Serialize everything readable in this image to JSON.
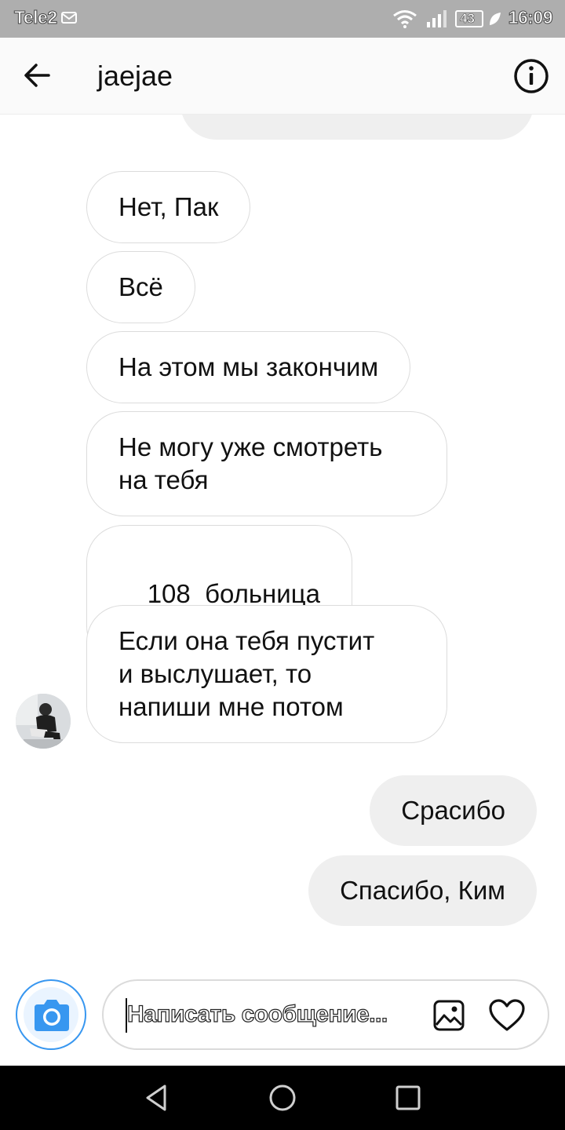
{
  "status_bar": {
    "carrier": "Tele2",
    "battery": "43",
    "time": "16:09"
  },
  "header": {
    "title": "jaejae",
    "back_icon": "arrow-left-icon",
    "info_icon": "info-circle-icon"
  },
  "messages": [
    {
      "sender": "them",
      "text": "Нет, Пак"
    },
    {
      "sender": "them",
      "text": "Всё"
    },
    {
      "sender": "them",
      "text": "На этом мы закончим"
    },
    {
      "sender": "them",
      "lines": [
        "Не могу уже смотреть",
        "на тебя"
      ]
    },
    {
      "sender": "them",
      "text": "108  больница"
    },
    {
      "sender": "them",
      "lines": [
        "Если она тебя пустит",
        "и выслушает, то",
        "напиши мне потом"
      ]
    },
    {
      "sender": "me",
      "text": "Срасибо"
    },
    {
      "sender": "me",
      "text": "Спасибо, Ким"
    }
  ],
  "composer": {
    "placeholder": "Написать сообщение...",
    "camera_icon": "camera-icon",
    "gallery_icon": "image-icon",
    "like_icon": "heart-icon"
  },
  "colors": {
    "accent": "#3897f0",
    "outgoing_bubble": "#efefef",
    "incoming_border": "#dcdcdc",
    "status_bar": "#aeaeae",
    "nav_bar": "#000000"
  }
}
